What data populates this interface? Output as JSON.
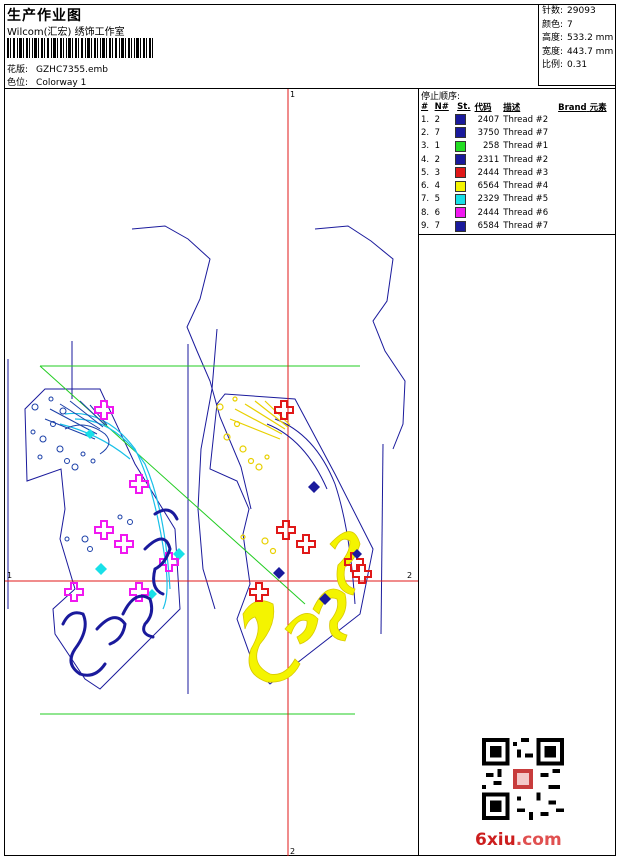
{
  "header": {
    "title": "生产作业图",
    "studio": "Wilcom(汇宏) 绣饰工作室",
    "design_label": "花版:",
    "design_value": "GZHC7355.emb",
    "colorway_label": "色位:",
    "colorway_value": "Colorway 1"
  },
  "stats": {
    "stitches_label": "针数:",
    "stitches_value": "29093",
    "colors_label": "颜色:",
    "colors_value": "7",
    "height_label": "高度:",
    "height_value": "533.2 mm",
    "width_label": "宽度:",
    "width_value": "443.7 mm",
    "scale_label": "比例:",
    "scale_value": "0.31"
  },
  "stop_sequence": {
    "title": "停止顺序:",
    "columns": [
      "#",
      "N#",
      "St.",
      "代码",
      "描述",
      "Brand",
      "元素"
    ],
    "rows": [
      {
        "idx": "1.",
        "n": "2",
        "color": "#1a1a9c",
        "code": "2407",
        "desc": "Thread #2"
      },
      {
        "idx": "2.",
        "n": "7",
        "color": "#1a1a9c",
        "code": "3750",
        "desc": "Thread #7"
      },
      {
        "idx": "3.",
        "n": "1",
        "color": "#22dd22",
        "code": "258",
        "desc": "Thread #1"
      },
      {
        "idx": "4.",
        "n": "2",
        "color": "#1a1a9c",
        "code": "2311",
        "desc": "Thread #2"
      },
      {
        "idx": "5.",
        "n": "3",
        "color": "#e01818",
        "code": "2444",
        "desc": "Thread #3"
      },
      {
        "idx": "6.",
        "n": "4",
        "color": "#f4f400",
        "code": "6564",
        "desc": "Thread #4"
      },
      {
        "idx": "7.",
        "n": "5",
        "color": "#18e0e8",
        "code": "2329",
        "desc": "Thread #5"
      },
      {
        "idx": "8.",
        "n": "6",
        "color": "#f018f0",
        "code": "2444",
        "desc": "Thread #6"
      },
      {
        "idx": "9.",
        "n": "7",
        "color": "#1a1a9c",
        "code": "6584",
        "desc": "Thread #7"
      }
    ]
  },
  "axis_markers": {
    "top": "1",
    "left": "1",
    "right": "2",
    "bottom": "2"
  },
  "watermark": {
    "brand_main": "6xiu",
    "brand_suffix": ".com"
  }
}
